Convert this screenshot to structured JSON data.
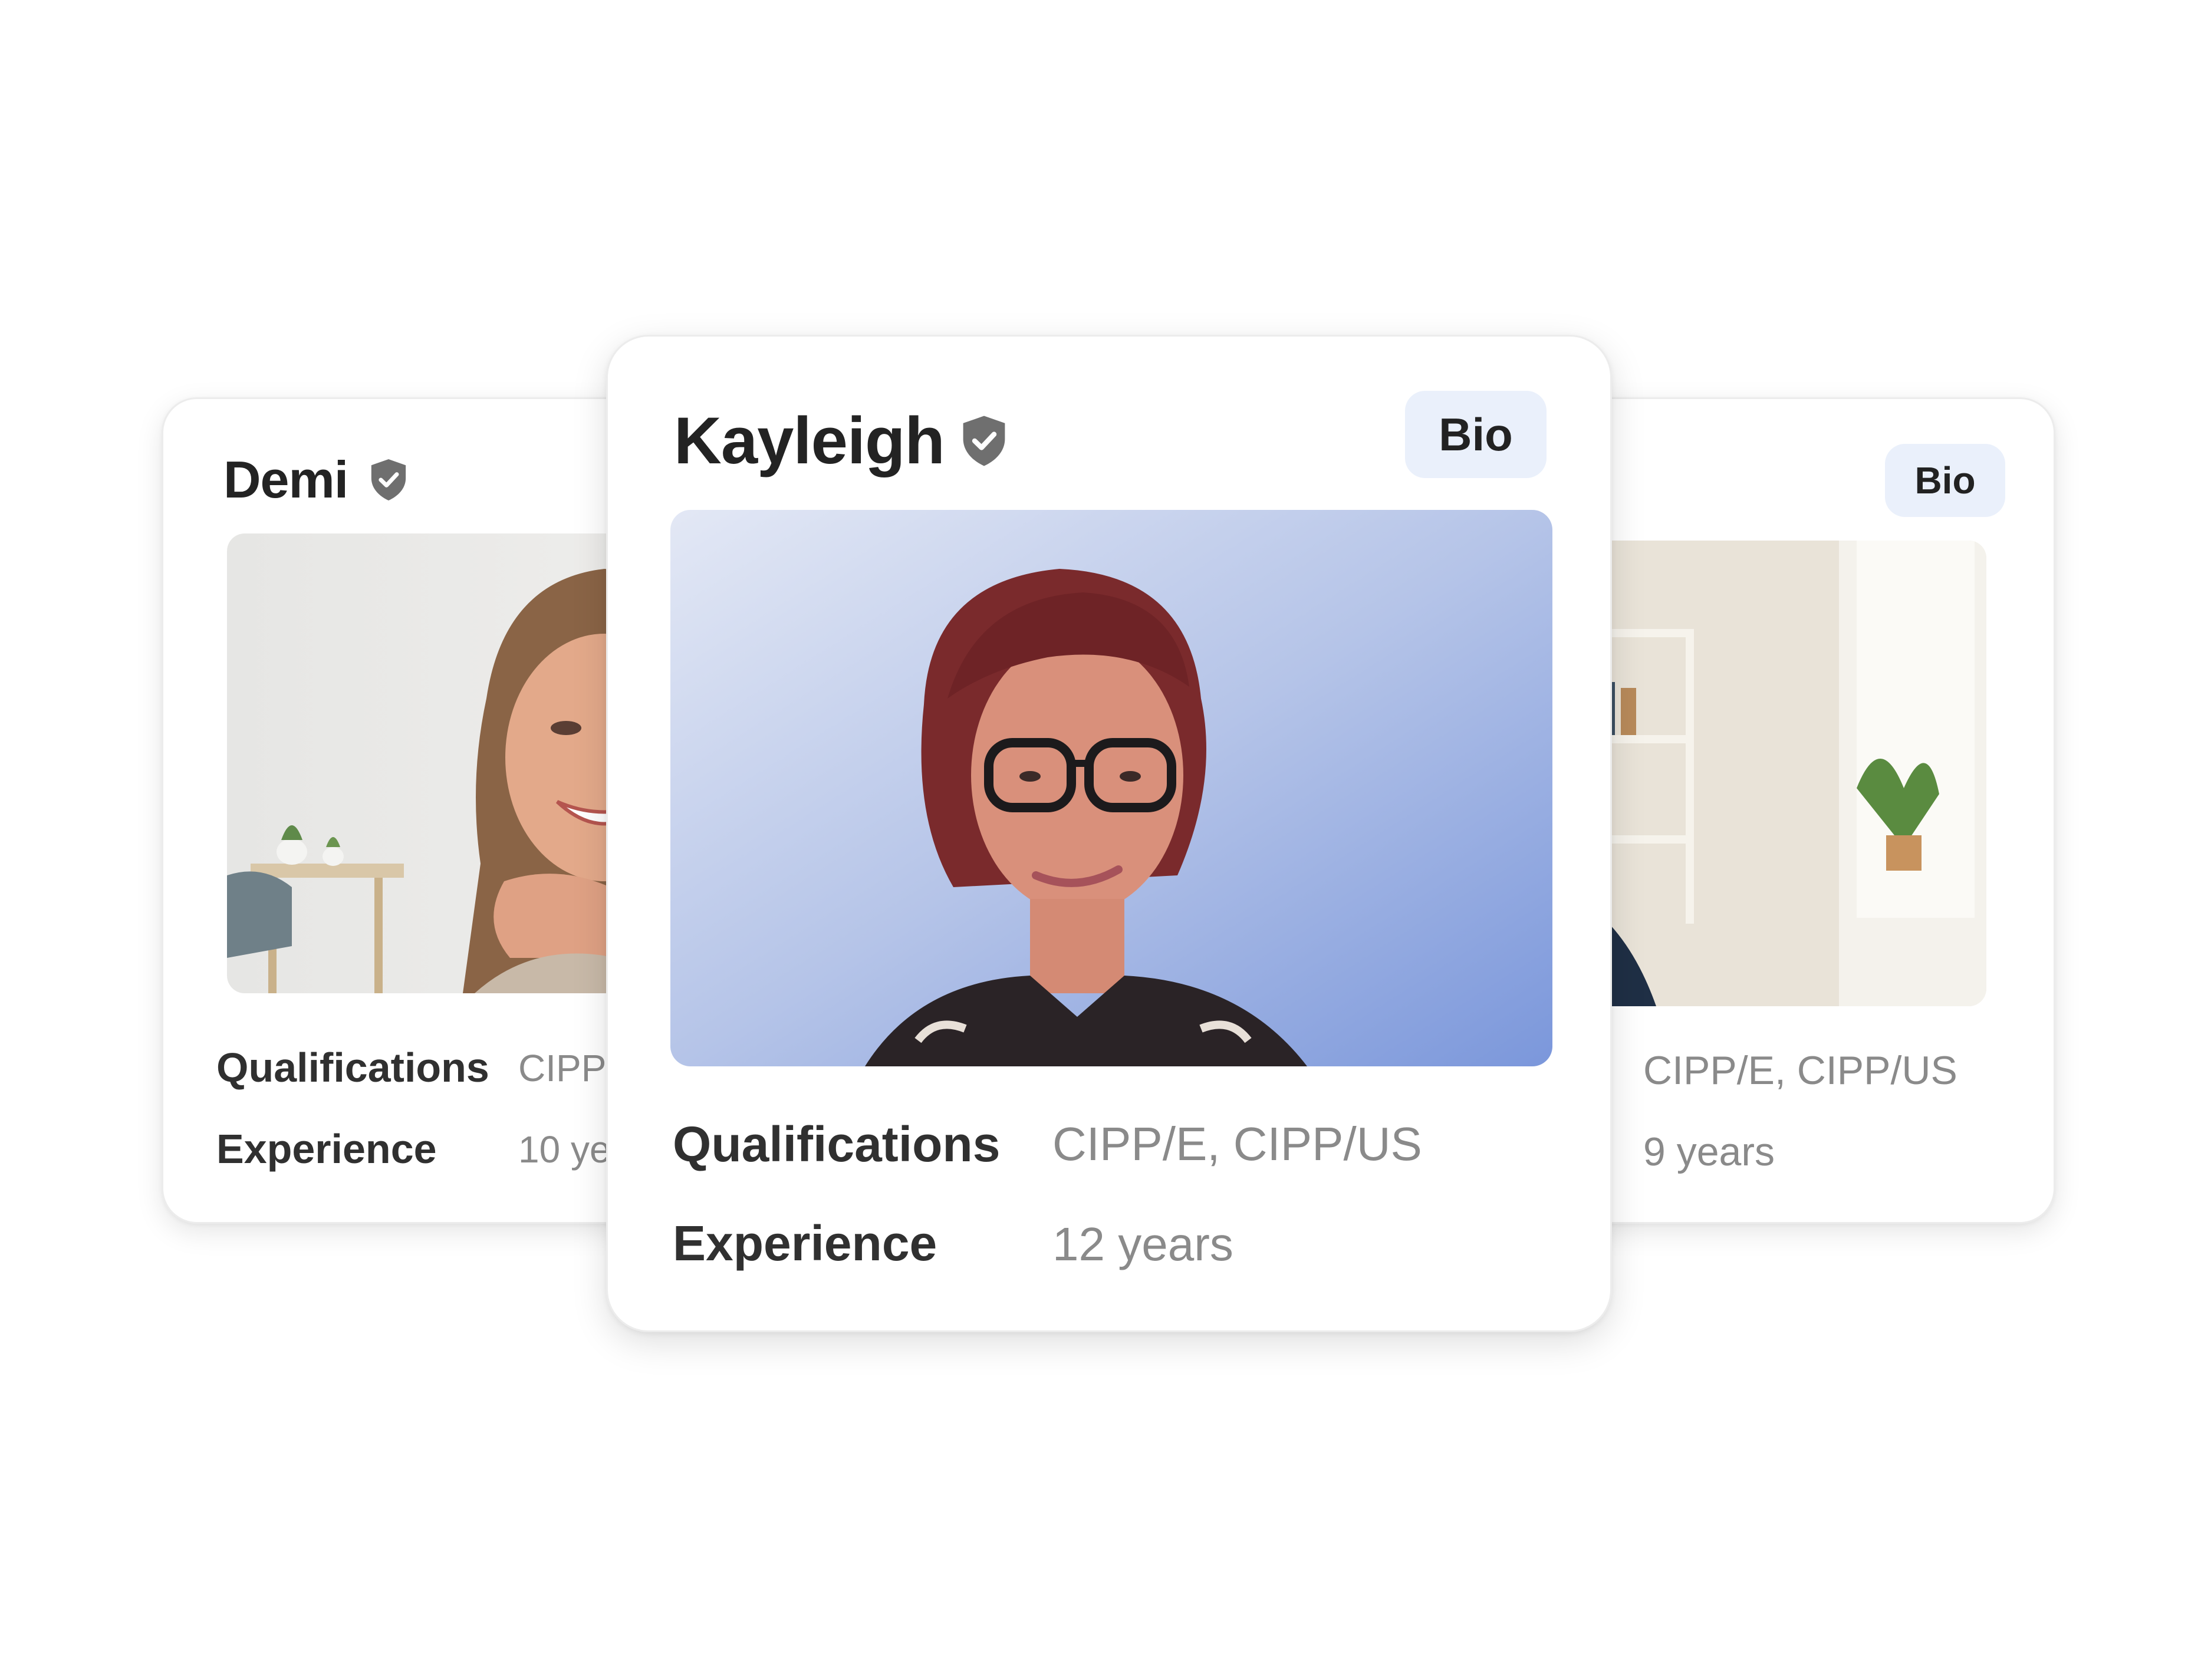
{
  "cards": {
    "left": {
      "name": "Demi",
      "badge_icon": "verified-shield-icon",
      "qualifications_label": "Qualifications",
      "qualifications_value": "CIPP/",
      "experience_label": "Experience",
      "experience_value": "10 ye"
    },
    "main": {
      "name": "Kayleigh",
      "badge_icon": "verified-shield-icon",
      "bio_label": "Bio",
      "qualifications_label": "Qualifications",
      "qualifications_value": "CIPP/E, CIPP/US",
      "experience_label": "Experience",
      "experience_value": "12 years"
    },
    "right": {
      "bio_label": "Bio",
      "qualifications_value": "CIPP/E, CIPP/US",
      "experience_value": "9 years"
    }
  },
  "colors": {
    "bio_button_bg": "#eaf0fb",
    "label_text": "#303030",
    "value_text": "#8a8a8a",
    "shield_icon": "#6f6f6f"
  }
}
